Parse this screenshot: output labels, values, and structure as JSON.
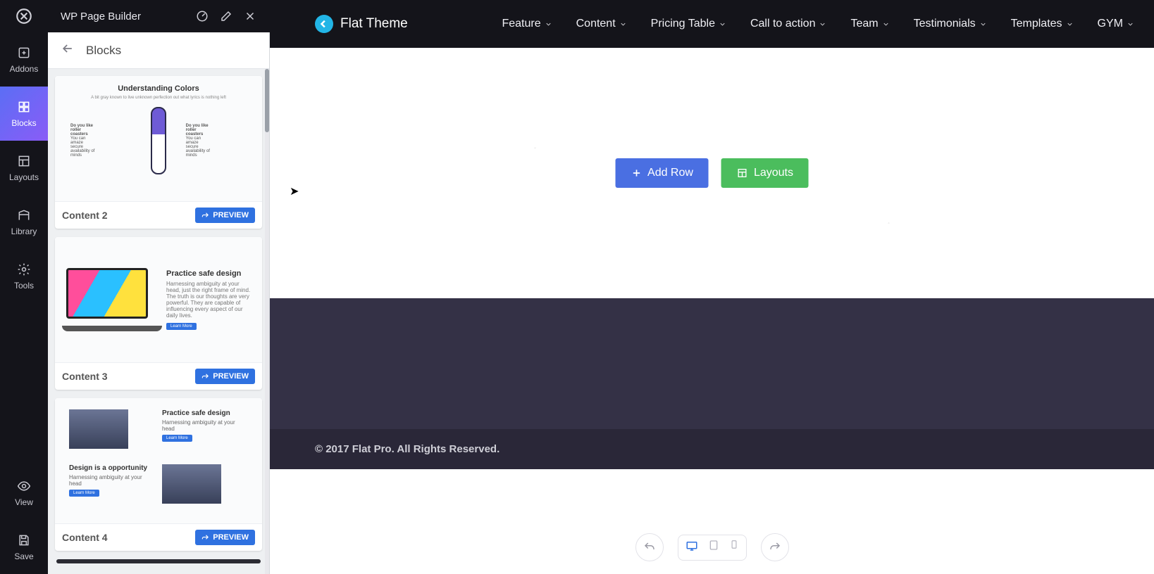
{
  "app": {
    "title": "WP Page Builder"
  },
  "rail": {
    "items": [
      {
        "id": "addons",
        "label": "Addons"
      },
      {
        "id": "blocks",
        "label": "Blocks"
      },
      {
        "id": "layouts",
        "label": "Layouts"
      },
      {
        "id": "library",
        "label": "Library"
      },
      {
        "id": "tools",
        "label": "Tools"
      }
    ],
    "view": "View",
    "save": "Save"
  },
  "panel": {
    "title": "Blocks",
    "preview_label": "PREVIEW",
    "cards": [
      {
        "name": "Content 2",
        "thumb_title": "Understanding Colors"
      },
      {
        "name": "Content 3",
        "thumb_title": "Practice safe design"
      },
      {
        "name": "Content 4",
        "thumb_title_a": "Practice safe design",
        "thumb_title_b": "Design is a opportunity"
      }
    ]
  },
  "site": {
    "brand": "Flat Theme",
    "menu": [
      "Feature",
      "Content",
      "Pricing Table",
      "Call to action",
      "Team",
      "Testimonials",
      "Templates",
      "GYM"
    ],
    "footer": "© 2017 Flat Pro. All Rights Reserved."
  },
  "dropzone": {
    "add_row": "Add Row",
    "layouts": "Layouts"
  },
  "colors": {
    "accent_blue": "#4a6fe2",
    "accent_green": "#4bbd5d",
    "preview_blue": "#2f71e0"
  }
}
